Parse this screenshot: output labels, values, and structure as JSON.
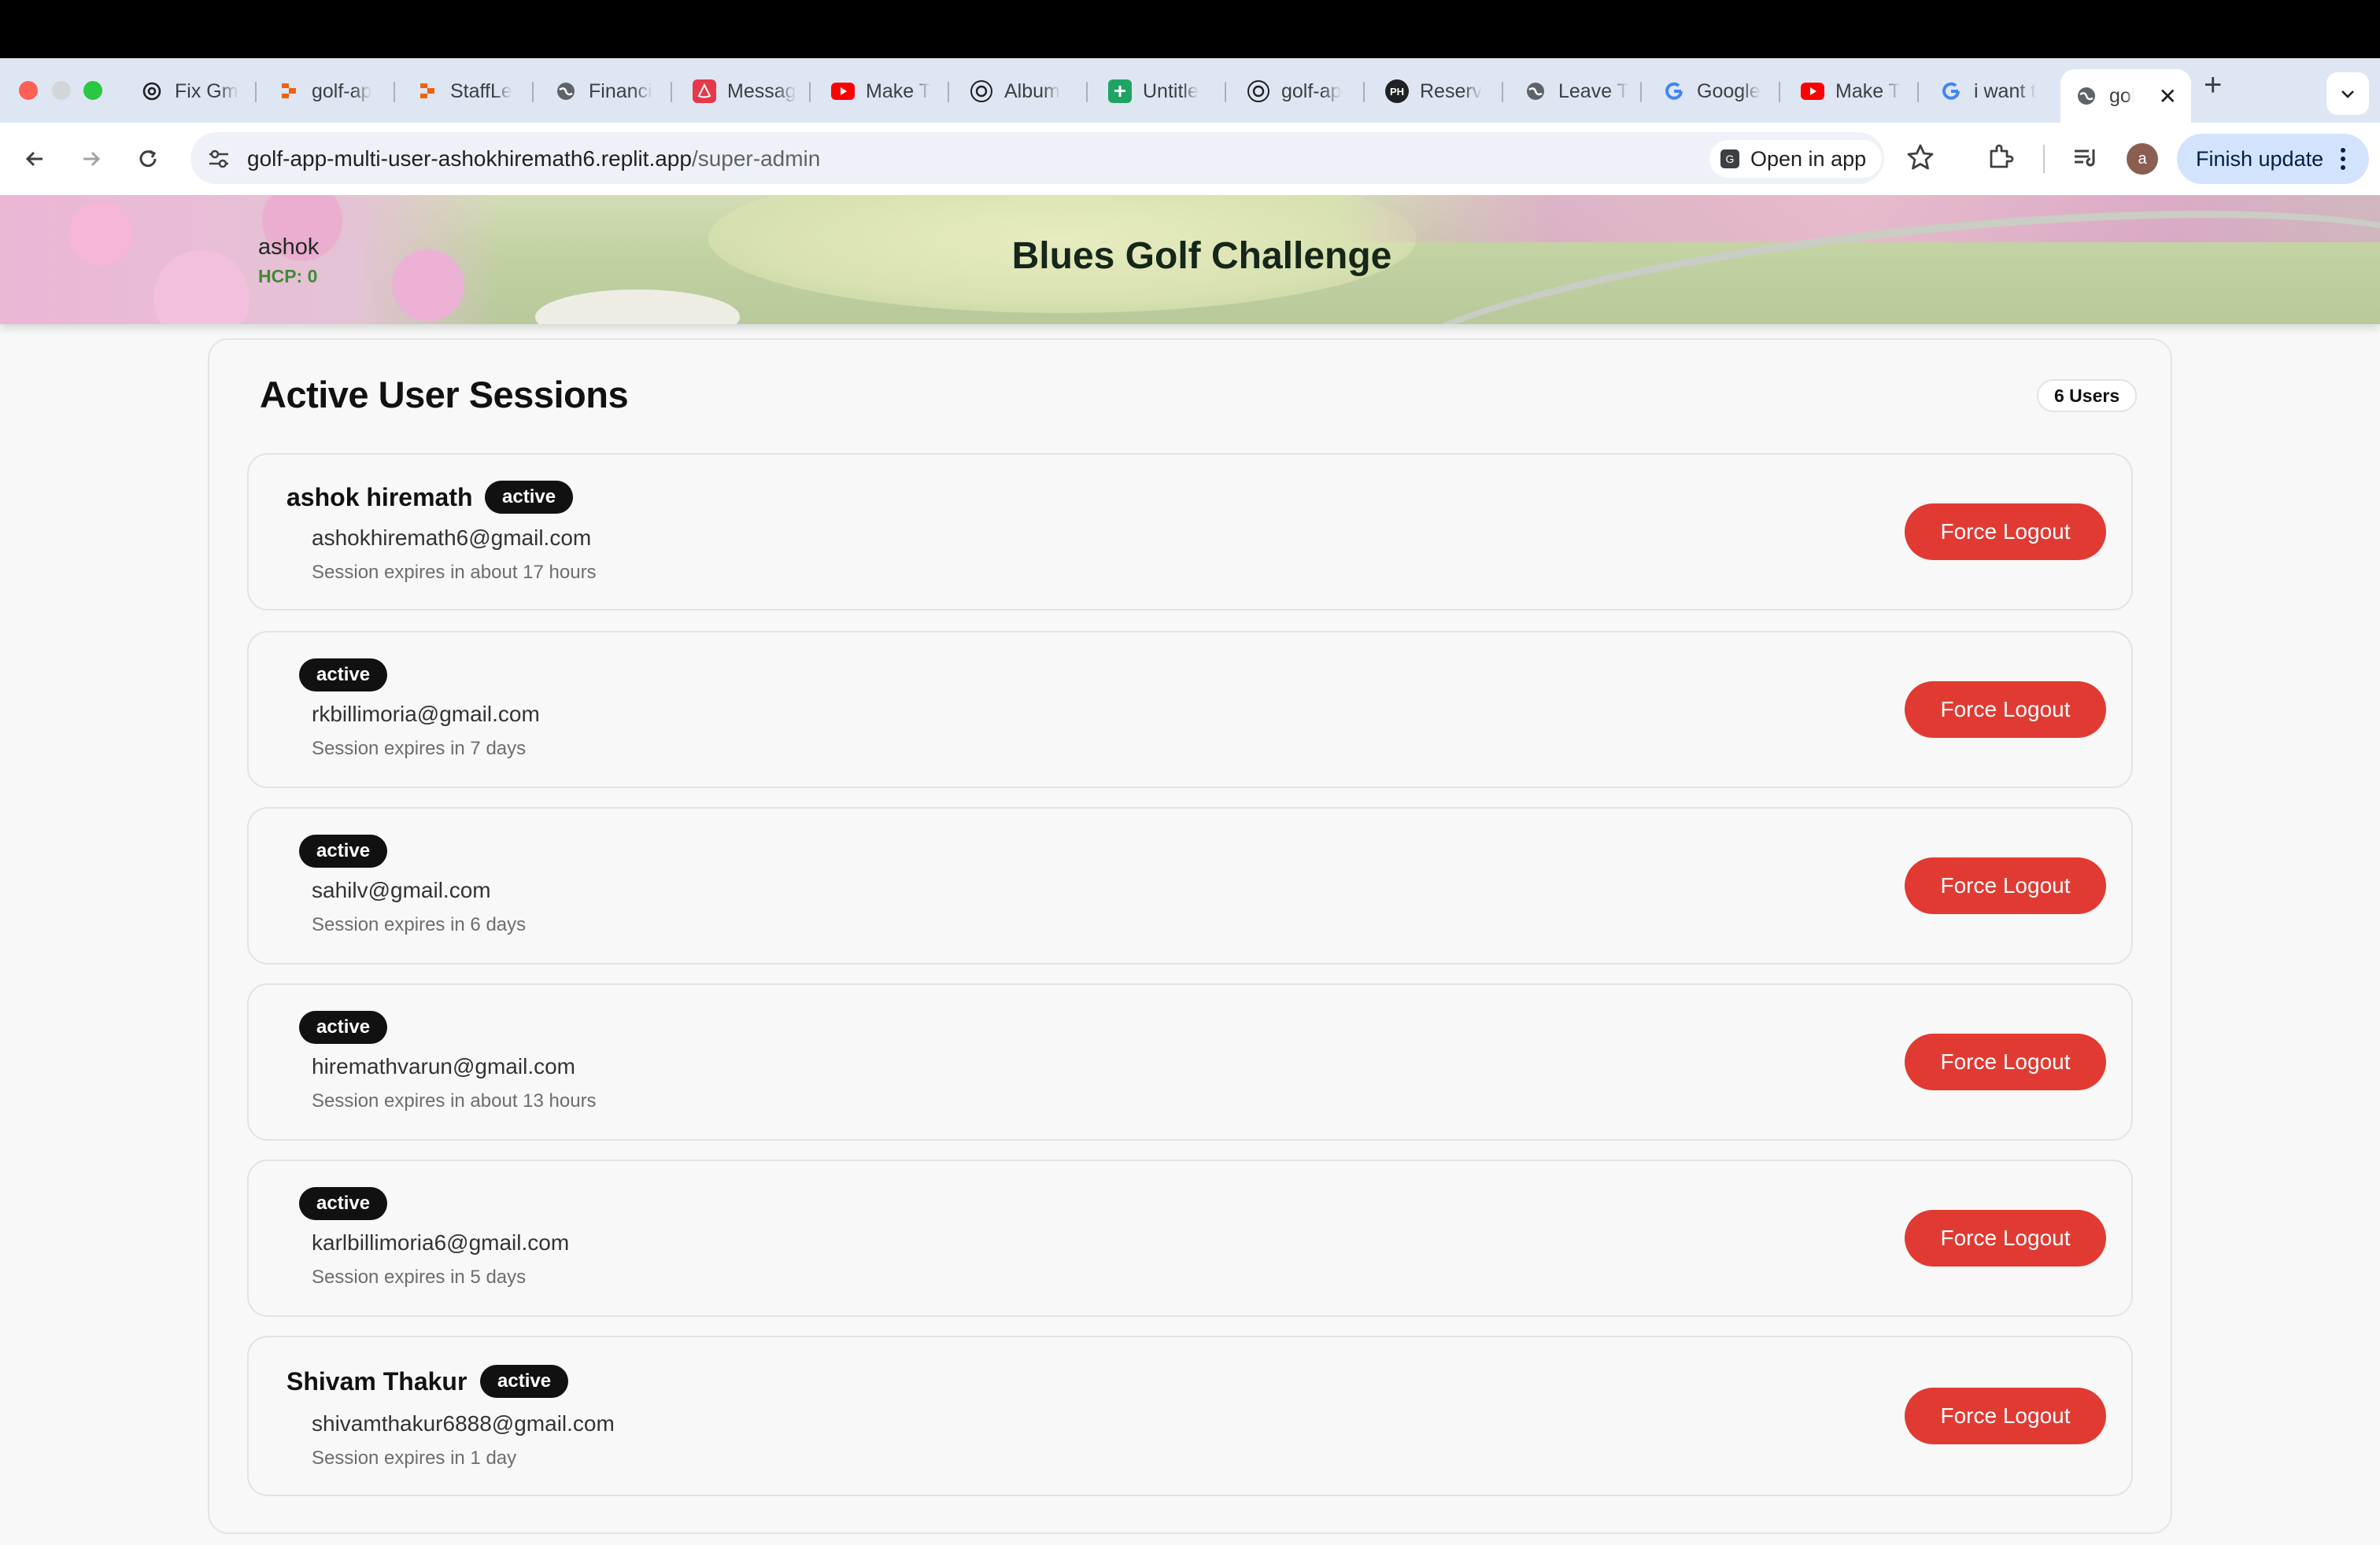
{
  "browser": {
    "tabs": [
      {
        "label": "Fix Gm",
        "icon": "openai-icon"
      },
      {
        "label": "golf-ap",
        "icon": "replit-icon"
      },
      {
        "label": "StaffLe",
        "icon": "replit-icon"
      },
      {
        "label": "Financi",
        "icon": "globe-icon"
      },
      {
        "label": "Messag",
        "icon": "airbnb-icon"
      },
      {
        "label": "Make T",
        "icon": "youtube-icon"
      },
      {
        "label": "Album",
        "icon": "openai-icon"
      },
      {
        "label": "Untitle",
        "icon": "sheets-icon"
      },
      {
        "label": "golf-ap",
        "icon": "openai-icon"
      },
      {
        "label": "Reserv",
        "icon": "ph-icon"
      },
      {
        "label": "Leave T",
        "icon": "globe-icon"
      },
      {
        "label": "Google",
        "icon": "google-icon"
      },
      {
        "label": "Make T",
        "icon": "youtube-icon"
      },
      {
        "label": "i want t",
        "icon": "google-icon"
      },
      {
        "label": "gol",
        "icon": "globe-icon"
      }
    ],
    "new_tab": "+",
    "url_host": "golf-app-multi-user-ashokhiremath6.replit.app",
    "url_path": "/super-admin",
    "open_in_app": "Open in app",
    "open_in_app_icon": "G",
    "avatar_initial": "a",
    "finish_update": "Finish update"
  },
  "header": {
    "user": "ashok",
    "hcp": "HCP: 0",
    "title": "Blues Golf Challenge"
  },
  "sessions_panel": {
    "title": "Active User Sessions",
    "count_label": "6 Users",
    "button_label": "Force Logout",
    "sessions": [
      {
        "name": "ashok hiremath",
        "status": "active",
        "email": "ashokhiremath6@gmail.com",
        "expires": "Session expires in about 17 hours"
      },
      {
        "name": "",
        "status": "active",
        "email": "rkbillimoria@gmail.com",
        "expires": "Session expires in 7 days"
      },
      {
        "name": "",
        "status": "active",
        "email": "sahilv@gmail.com",
        "expires": "Session expires in 6 days"
      },
      {
        "name": "",
        "status": "active",
        "email": "hiremathvarun@gmail.com",
        "expires": "Session expires in about 13 hours"
      },
      {
        "name": "",
        "status": "active",
        "email": "karlbillimoria6@gmail.com",
        "expires": "Session expires in 5 days"
      },
      {
        "name": "Shivam Thakur",
        "status": "active",
        "email": "shivamthakur6888@gmail.com",
        "expires": "Session expires in 1 day"
      }
    ]
  },
  "colors": {
    "force_logout": "#e13a33",
    "badge": "#111111",
    "hcp": "#3f8a36"
  }
}
